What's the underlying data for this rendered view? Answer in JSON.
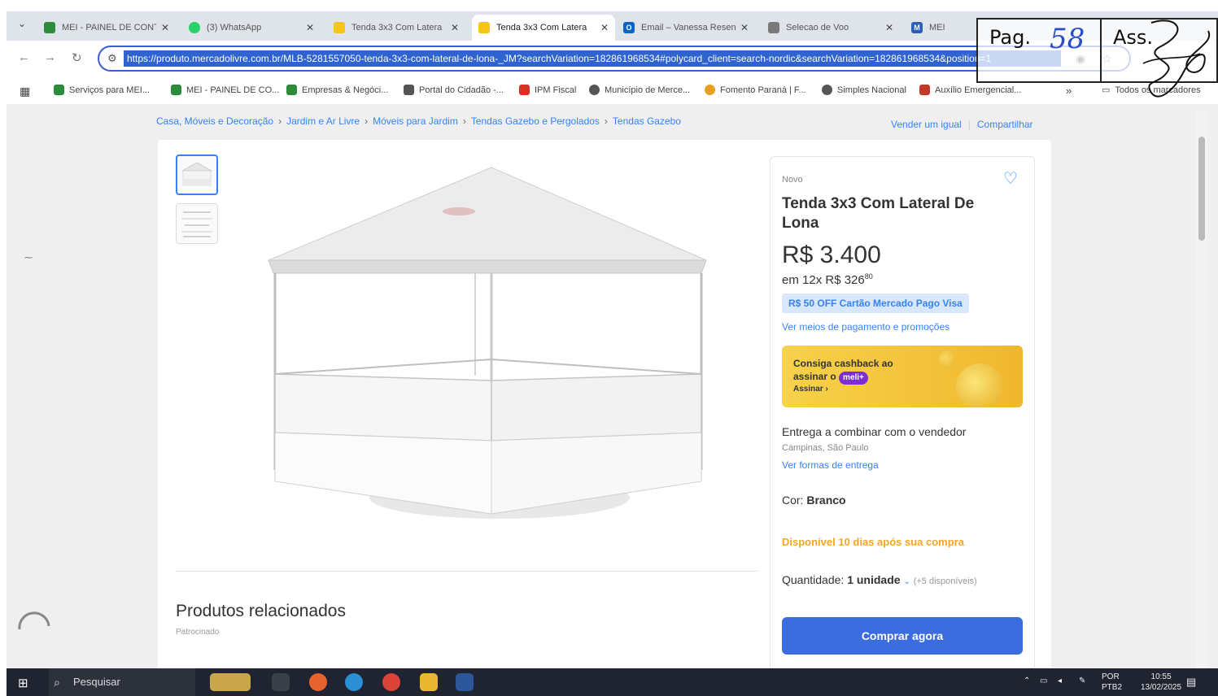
{
  "tabs": [
    {
      "title": "MEI - PAINEL DE CONT",
      "icon": "mei-favicon",
      "color": "#2c8c3c",
      "active": false
    },
    {
      "title": "(3) WhatsApp",
      "icon": "whatsapp-favicon",
      "color": "#25d366",
      "active": false
    },
    {
      "title": "Tenda 3x3 Com Latera",
      "icon": "mercadolivre-favicon",
      "color": "#f5c518",
      "active": false
    },
    {
      "title": "Tenda 3x3 Com Latera",
      "icon": "mercadolivre-favicon",
      "color": "#f5c518",
      "active": true
    },
    {
      "title": "Email – Vanessa Resen",
      "icon": "outlook-favicon",
      "color": "#0a64c8",
      "active": false
    },
    {
      "title": "Selecao de Voo",
      "icon": "flight-favicon",
      "color": "#7a7a7a",
      "active": false
    },
    {
      "title": "MEI",
      "icon": "mei-favicon",
      "color": "#2c5fb8",
      "active": false
    }
  ],
  "address": {
    "url": "https://produto.mercadolivre.com.br/MLB-5281557050-tenda-3x3-com-lateral-de-lona-_JM?searchVariation=182861968534#polycard_client=search-nordic&searchVariation=182861968534&position=1"
  },
  "bookmarks": [
    {
      "label": "Serviços para MEI...",
      "color": "#2c8c3c"
    },
    {
      "label": "MEI - PAINEL DE CO...",
      "color": "#2c8c3c"
    },
    {
      "label": "Empresas & Negóci...",
      "color": "#2c8c3c"
    },
    {
      "label": "Portal do Cidadão -...",
      "color": "#555555"
    },
    {
      "label": "IPM Fiscal",
      "color": "#d93025"
    },
    {
      "label": "Município de Merce...",
      "color": "#555555"
    },
    {
      "label": "Fomento Paraná | F...",
      "color": "#e8a020"
    },
    {
      "label": "Simples Nacional",
      "color": "#555555"
    },
    {
      "label": "Auxílio Emergencial...",
      "color": "#c0392b"
    }
  ],
  "bookmarks_more": "»",
  "bookmarks_folder": "Todos os marcadores",
  "breadcrumb": [
    "Casa, Móveis e Decoração",
    "Jardim e Ar Livre",
    "Móveis para Jardim",
    "Tendas Gazebo e Pergolados",
    "Tendas Gazebo"
  ],
  "top_links": {
    "sell": "Vender um igual",
    "share": "Compartilhar"
  },
  "product": {
    "condition": "Novo",
    "title": "Tenda 3x3 Com Lateral De Lona",
    "price": "R$ 3.400",
    "installments": "em 12x R$ 326",
    "installments_cents": "80",
    "promo": "R$ 50 OFF Cartão Mercado Pago Visa",
    "payment_link": "Ver meios de pagamento e promoções",
    "cashback_line1": "Consiga cashback ao",
    "cashback_line2": "assinar o",
    "cashback_badge": "meli+",
    "cashback_cta": "Assinar  ›",
    "delivery": "Entrega a combinar com o vendedor",
    "location": "Campinas, São Paulo",
    "shipping_link": "Ver formas de entrega",
    "color_label": "Cor:",
    "color_value": "Branco",
    "availability": "Disponível 10 dias após sua compra",
    "quantity_label": "Quantidade:",
    "quantity_value": "1 unidade",
    "stock": "(+5 disponíveis)",
    "buy_button": "Comprar agora"
  },
  "related": {
    "title": "Produtos relacionados",
    "sponsored": "Patrocinado"
  },
  "taskbar": {
    "search": "Pesquisar",
    "lang": "POR",
    "layout": "PTB2",
    "time": "10:55",
    "date": "13/02/2025"
  },
  "stamp": {
    "pag_label": "Pag.",
    "pag_number": "58",
    "ass_label": "Ass."
  }
}
